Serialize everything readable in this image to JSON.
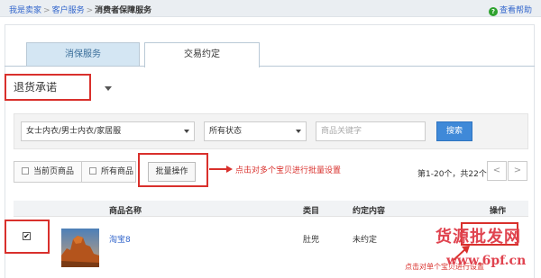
{
  "breadcrumb": {
    "items": [
      "我是卖家",
      "客户服务",
      "消费者保障服务"
    ],
    "separator": ">"
  },
  "help": {
    "icon": "question-icon",
    "label": "查看帮助"
  },
  "tabs": [
    {
      "label": "消保服务",
      "active": false
    },
    {
      "label": "交易约定",
      "active": true
    }
  ],
  "promise_select": {
    "value": "退货承诺"
  },
  "filters": {
    "category": "女士内衣/男士内衣/家居服",
    "status": "所有状态",
    "keyword_placeholder": "商品关键字",
    "search_label": "搜索"
  },
  "toolbar": {
    "current_page_label": "当前页商品",
    "all_items_label": "所有商品",
    "batch_label": "批量操作",
    "pager_info": "第1-20个，共22个",
    "prev_label": "<",
    "next_label": ">"
  },
  "annotations": {
    "batch": "点击对多个宝贝进行批量设置",
    "single": "点击对单个宝贝进行设置"
  },
  "table": {
    "headers": {
      "name": "商品名称",
      "category": "类目",
      "content": "约定内容",
      "op": "操作"
    },
    "rows": [
      {
        "checked": true,
        "check_mark": "✔",
        "name": "淘宝8",
        "category": "肚兜",
        "content": "未约定",
        "op": ""
      }
    ]
  },
  "watermark": {
    "text": "货源批发网",
    "url": "www.6pf.cn"
  },
  "colors": {
    "accent_red": "#d9302c",
    "link_blue": "#3366cc",
    "search_button": "#3f89d8",
    "tab_active_bg": "#d4e6f3"
  }
}
